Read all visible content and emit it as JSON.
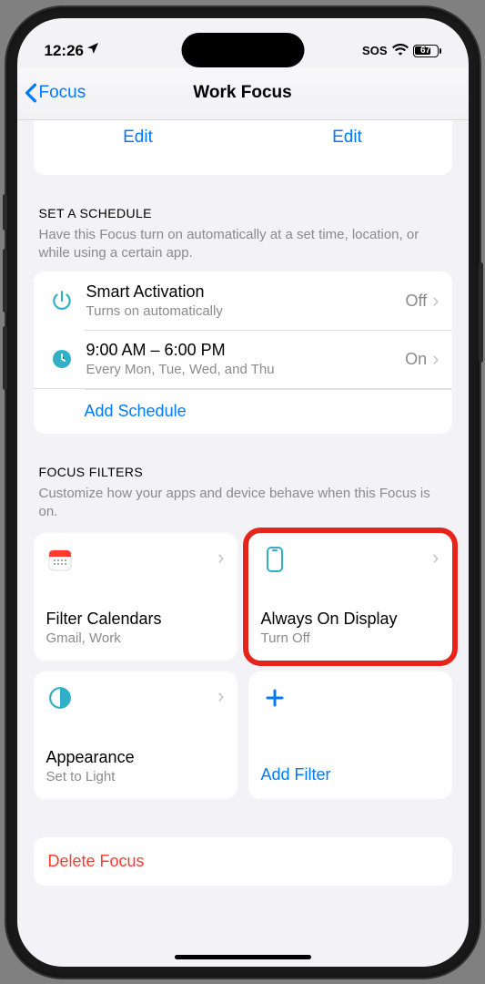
{
  "status": {
    "time": "12:26",
    "sos": "SOS",
    "battery_pct": "67"
  },
  "nav": {
    "back_label": "Focus",
    "title": "Work Focus"
  },
  "edit": {
    "left": "Edit",
    "right": "Edit"
  },
  "schedule": {
    "header": "SET A SCHEDULE",
    "sub": "Have this Focus turn on automatically at a set time, location, or while using a certain app.",
    "rows": [
      {
        "title": "Smart Activation",
        "sub": "Turns on automatically",
        "value": "Off"
      },
      {
        "title": "9:00 AM – 6:00 PM",
        "sub": "Every Mon, Tue, Wed, and Thu",
        "value": "On"
      }
    ],
    "add": "Add Schedule"
  },
  "filters": {
    "header": "FOCUS FILTERS",
    "sub": "Customize how your apps and device behave when this Focus is on.",
    "cards": [
      {
        "title": "Filter Calendars",
        "sub": "Gmail, Work"
      },
      {
        "title": "Always On Display",
        "sub": "Turn Off"
      },
      {
        "title": "Appearance",
        "sub": "Set to Light"
      }
    ],
    "add": "Add Filter"
  },
  "delete": {
    "label": "Delete Focus"
  }
}
